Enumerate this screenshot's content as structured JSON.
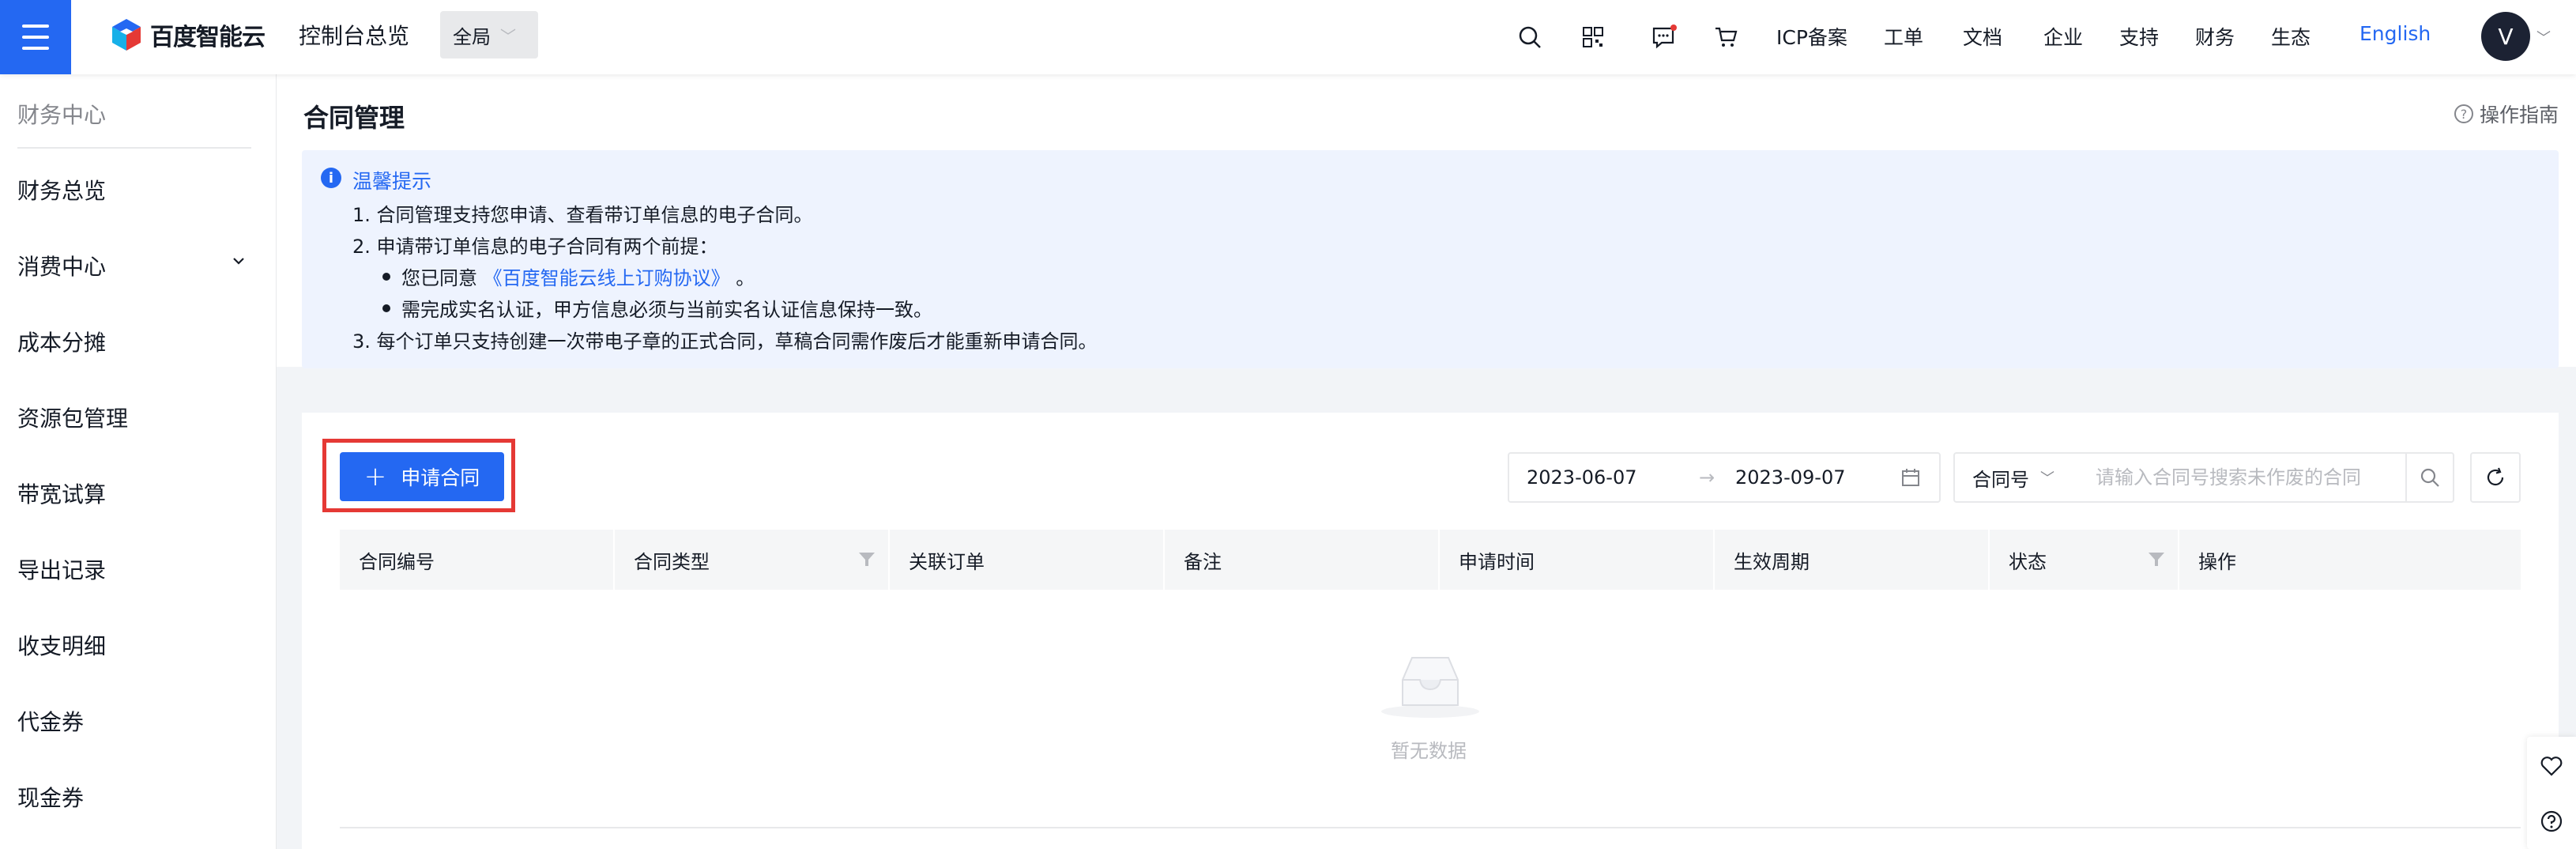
{
  "brand": {
    "logo_text": "百度智能云",
    "accent": "#2468f2"
  },
  "header": {
    "console_title": "控制台总览",
    "scope": "全局",
    "icons": [
      "search-icon",
      "qrcode-icon",
      "message-icon",
      "cart-icon"
    ],
    "links": [
      "ICP备案",
      "工单",
      "文档",
      "企业",
      "支持",
      "财务",
      "生态"
    ],
    "language": "English",
    "avatar_initial": "V"
  },
  "sidebar": {
    "title": "财务中心",
    "items": [
      {
        "label": "财务总览"
      },
      {
        "label": "消费中心"
      },
      {
        "label": "成本分摊"
      },
      {
        "label": "资源包管理"
      },
      {
        "label": "带宽试算"
      },
      {
        "label": "导出记录"
      },
      {
        "label": "收支明细"
      },
      {
        "label": "代金券"
      },
      {
        "label": "现金券"
      }
    ]
  },
  "page": {
    "title": "合同管理",
    "guide_label": "操作指南"
  },
  "notice": {
    "title": "温馨提示",
    "line1": "1. 合同管理支持您申请、查看带订单信息的电子合同。",
    "line2": "2. 申请带订单信息的电子合同有两个前提：",
    "bullet1_prefix": "您已同意",
    "bullet1_link": "《百度智能云线上订购协议》",
    "bullet1_suffix": "。",
    "bullet2": "需完成实名认证，甲方信息必须与当前实名认证信息保持一致。",
    "line3": "3. 每个订单只支持创建一次带电子章的正式合同，草稿合同需作废后才能重新申请合同。"
  },
  "toolbar": {
    "apply_label": "申请合同",
    "date_start": "2023-06-07",
    "date_end": "2023-09-07",
    "date_separator": "→",
    "field_select": "合同号",
    "search_placeholder": "请输入合同号搜索未作废的合同"
  },
  "table": {
    "columns": [
      "合同编号",
      "合同类型",
      "关联订单",
      "备注",
      "申请时间",
      "生效周期",
      "状态",
      "操作"
    ],
    "empty_text": "暂无数据"
  }
}
